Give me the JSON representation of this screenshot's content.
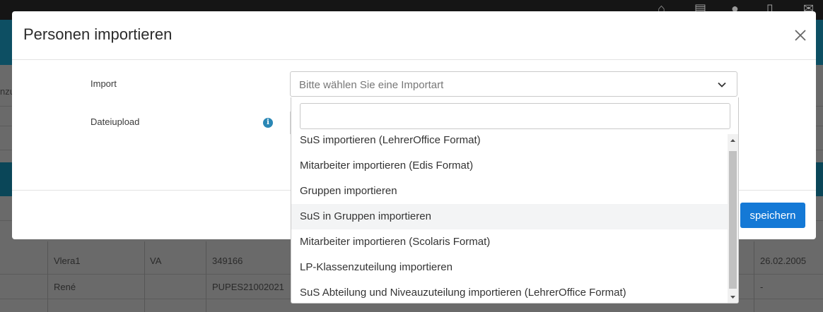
{
  "background": {
    "left_edge_text": "nzu",
    "rows": [
      {
        "name": "Vlera1",
        "code": "VA",
        "id": "349166",
        "date": "26.02.2005"
      },
      {
        "name": "René",
        "code": "",
        "id": "PUPES21002021",
        "date": "-"
      }
    ]
  },
  "modal": {
    "title": "Personen importieren",
    "import_label": "Import",
    "upload_label": "Dateiupload",
    "select_placeholder": "Bitte wählen Sie eine Importart",
    "save_label": "speichern",
    "info_glyph": "i"
  },
  "dropdown": {
    "search_value": "",
    "options": [
      "SuS importieren (LehrerOffice Format)",
      "Mitarbeiter importieren (Edis Format)",
      "Gruppen importieren",
      "SuS in Gruppen importieren",
      "Mitarbeiter importieren (Scolaris Format)",
      "LP-Klassenzuteilung importieren",
      "SuS Abteilung und Niveauzuteilung importieren (LehrerOffice Format)"
    ],
    "hovered_index": 3
  },
  "colors": {
    "primary": "#1479d6",
    "info": "#2a87b5",
    "banner": "#0d4f63"
  }
}
